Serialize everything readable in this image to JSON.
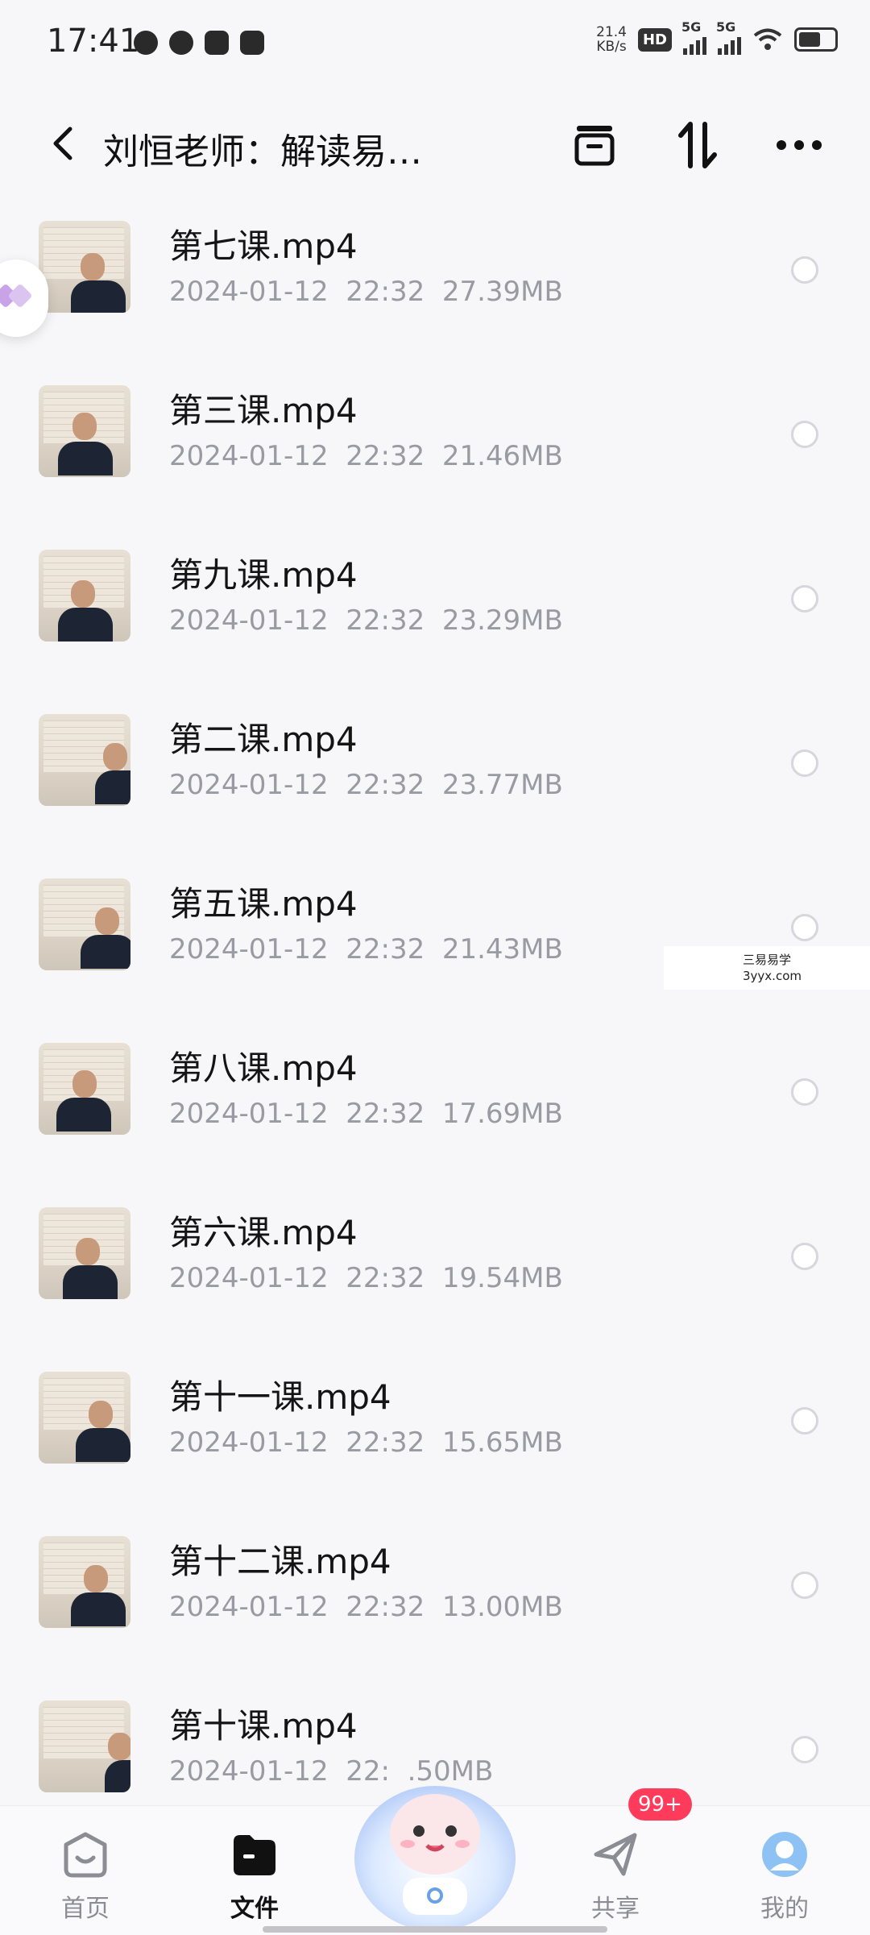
{
  "status_bar": {
    "time": "17:41",
    "net_speed_value": "21.4",
    "net_speed_unit": "KB/s",
    "hd": "HD",
    "sim1": "5G",
    "sim2": "5G"
  },
  "header": {
    "title": "刘恒老师：解读易…",
    "icons": [
      "back-icon",
      "archive-icon",
      "sort-icon",
      "more-icon"
    ]
  },
  "files": [
    {
      "name": "第七课.mp4",
      "date": "2024-01-12",
      "time": "22:32",
      "size": "27.39MB"
    },
    {
      "name": "第三课.mp4",
      "date": "2024-01-12",
      "time": "22:32",
      "size": "21.46MB"
    },
    {
      "name": "第九课.mp4",
      "date": "2024-01-12",
      "time": "22:32",
      "size": "23.29MB"
    },
    {
      "name": "第二课.mp4",
      "date": "2024-01-12",
      "time": "22:32",
      "size": "23.77MB"
    },
    {
      "name": "第五课.mp4",
      "date": "2024-01-12",
      "time": "22:32",
      "size": "21.43MB"
    },
    {
      "name": "第八课.mp4",
      "date": "2024-01-12",
      "time": "22:32",
      "size": "17.69MB"
    },
    {
      "name": "第六课.mp4",
      "date": "2024-01-12",
      "time": "22:32",
      "size": "19.54MB"
    },
    {
      "name": "第十一课.mp4",
      "date": "2024-01-12",
      "time": "22:32",
      "size": "15.65MB"
    },
    {
      "name": "第十二课.mp4",
      "date": "2024-01-12",
      "time": "22:32",
      "size": "13.00MB"
    },
    {
      "name": "第十课.mp4",
      "date": "2024-01-12",
      "time": "22:",
      "size": ".50MB"
    }
  ],
  "watermark": {
    "line1": "三易易学",
    "line2": "3yyx.com"
  },
  "bottom_nav": {
    "items": [
      {
        "label": "首页",
        "icon": "home-icon",
        "active": false
      },
      {
        "label": "文件",
        "icon": "folder-icon",
        "active": true
      },
      {
        "label": "共享",
        "icon": "share-icon",
        "active": false
      },
      {
        "label": "我的",
        "icon": "profile-icon",
        "active": false
      }
    ],
    "share_badge": "99+"
  },
  "colors": {
    "background": "#f7f7f9",
    "text_primary": "#141414",
    "text_secondary": "#9a9aa2",
    "badge": "#ff3b5c",
    "profile_accent": "#8ec2f5"
  }
}
